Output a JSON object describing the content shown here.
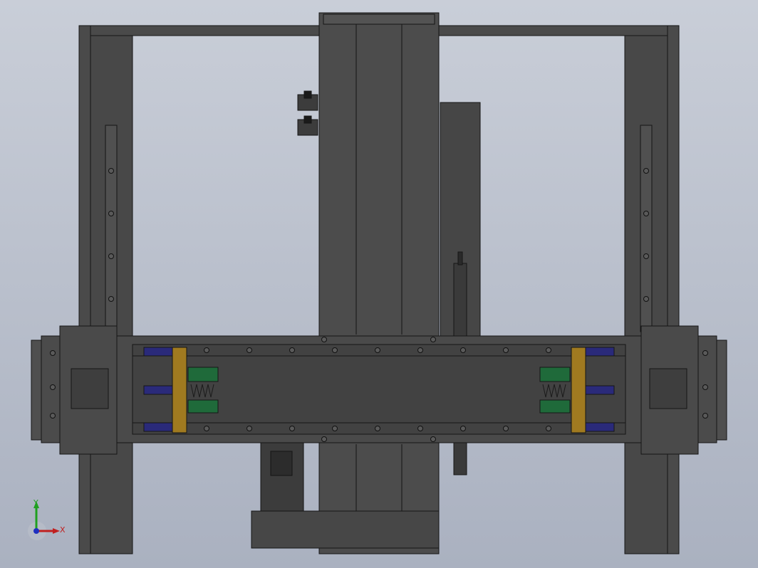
{
  "viewport": {
    "background_top": "#c9ced8",
    "background_bottom": "#aab1c0"
  },
  "model": {
    "body_color": "#4a4a4a",
    "edge_color": "#151515",
    "slider_color": "#2a2a7a",
    "clamp_color": "#a07a20",
    "spring_block_color": "#1f6a3a"
  },
  "triad": {
    "x_label": "X",
    "y_label": "Y",
    "x_color": "#c02020",
    "y_color": "#20a020",
    "z_color": "#2030c0"
  }
}
